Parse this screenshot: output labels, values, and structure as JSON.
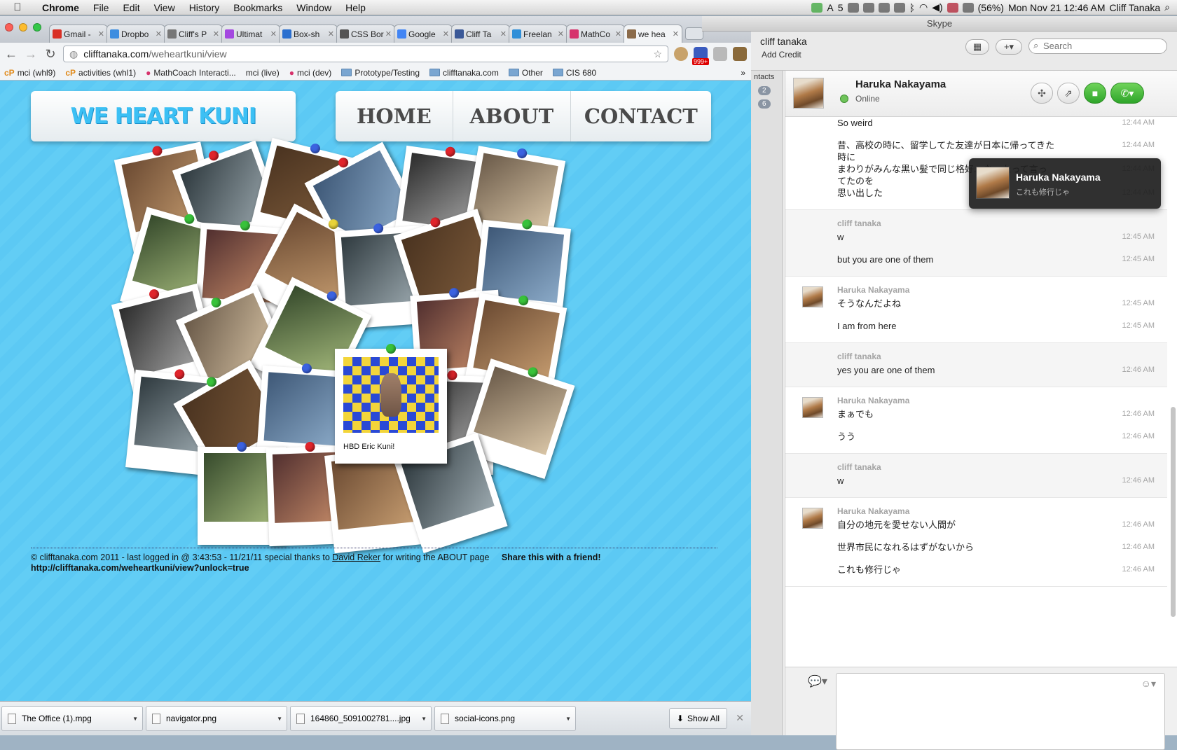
{
  "menubar": {
    "app": "Chrome",
    "items": [
      "File",
      "Edit",
      "View",
      "History",
      "Bookmarks",
      "Window",
      "Help"
    ],
    "status_5": "5",
    "battery": "(56%)",
    "datetime": "Mon Nov 21  12:46 AM",
    "user": "Cliff Tanaka"
  },
  "chrome": {
    "tabs": [
      {
        "label": "Gmail - ",
        "color": "#d93025"
      },
      {
        "label": "Dropbo",
        "color": "#3d8de0"
      },
      {
        "label": "Cliff's P",
        "color": "#777777"
      },
      {
        "label": "Ultimat",
        "color": "#a448e0"
      },
      {
        "label": "Box-sh",
        "color": "#2a6fcf"
      },
      {
        "label": "CSS Bor",
        "color": "#555555"
      },
      {
        "label": "Google",
        "color": "#4285f4"
      },
      {
        "label": "Cliff Ta",
        "color": "#3b5998"
      },
      {
        "label": "Freelan",
        "color": "#2f8fd8"
      },
      {
        "label": "MathCo",
        "color": "#d6336c"
      },
      {
        "label": "we hea",
        "color": "#8b6b4a"
      }
    ],
    "url_domain": "clifftanaka.com",
    "url_path": "/weheartkuni/view",
    "badge": "999+",
    "bookmarks": [
      "mci (whl9)",
      "activities (whl1)",
      "MathCoach Interacti...",
      "mci (live)",
      "mci (dev)",
      "Prototype/Testing",
      "clifftanaka.com",
      "Other",
      "CIS 680"
    ]
  },
  "site": {
    "logo": "WE HEART KUNI",
    "nav": [
      "HOME",
      "ABOUT",
      "CONTACT"
    ],
    "featured_caption": "HBD Eric Kuni!",
    "footer_prefix": "© clifftanaka.com 2011 - last logged in @ 3:43:53 - 11/21/11 special thanks to ",
    "footer_link": "David Reker",
    "footer_suffix": " for writing the ABOUT page",
    "share": "Share this with a friend!",
    "share_url": "http://clifftanaka.com/weheartkuni/view?unlock=true"
  },
  "downloads": {
    "items": [
      "The Office (1).mpg",
      "navigator.png",
      "164860_5091002781....jpg",
      "social-icons.png"
    ],
    "show_all": "Show All"
  },
  "skype": {
    "title": "Skype",
    "user": "cliff tanaka",
    "add_credit": "Add Credit",
    "search_placeholder": "Search",
    "contact_name": "Haruka Nakayama",
    "contact_status": "Online",
    "sidebar_tab": "ntacts",
    "badges": [
      "2",
      "6"
    ],
    "toast_name": "Haruka Nakayama",
    "toast_msg": "これも修行じゃ"
  },
  "messages": [
    {
      "who": "",
      "lines": [
        {
          "text": "So weird",
          "time": "12:44 AM"
        },
        {
          "text": "昔、高校の時に、留学してた友達が日本に帰ってきた時に",
          "time": "12:44 AM"
        },
        {
          "text": "まわりがみんな黒い髪で同じ格好... なったって言ってたのを",
          "time": "12:44 AM"
        },
        {
          "text": "思い出した",
          "time": "12:44 AM"
        }
      ]
    },
    {
      "who": "cliff tanaka",
      "me": true,
      "lines": [
        {
          "text": "w",
          "time": "12:45 AM"
        },
        {
          "text": "but you are one of them",
          "time": "12:45 AM"
        }
      ]
    },
    {
      "who": "Haruka Nakayama",
      "lines": [
        {
          "text": "そうなんだよね",
          "time": "12:45 AM"
        },
        {
          "text": "I am from here",
          "time": "12:45 AM"
        }
      ]
    },
    {
      "who": "cliff tanaka",
      "me": true,
      "lines": [
        {
          "text": "yes you are one of them",
          "time": "12:46 AM"
        }
      ]
    },
    {
      "who": "Haruka Nakayama",
      "lines": [
        {
          "text": "まぁでも",
          "time": "12:46 AM"
        },
        {
          "text": "うう",
          "time": "12:46 AM"
        }
      ]
    },
    {
      "who": "cliff tanaka",
      "me": true,
      "lines": [
        {
          "text": "w",
          "time": "12:46 AM"
        }
      ]
    },
    {
      "who": "Haruka Nakayama",
      "lines": [
        {
          "text": "自分の地元を愛せない人間が",
          "time": "12:46 AM"
        },
        {
          "text": "世界市民になれるはずがないから",
          "time": "12:46 AM"
        },
        {
          "text": "これも修行じゃ",
          "time": "12:46 AM"
        }
      ]
    }
  ]
}
